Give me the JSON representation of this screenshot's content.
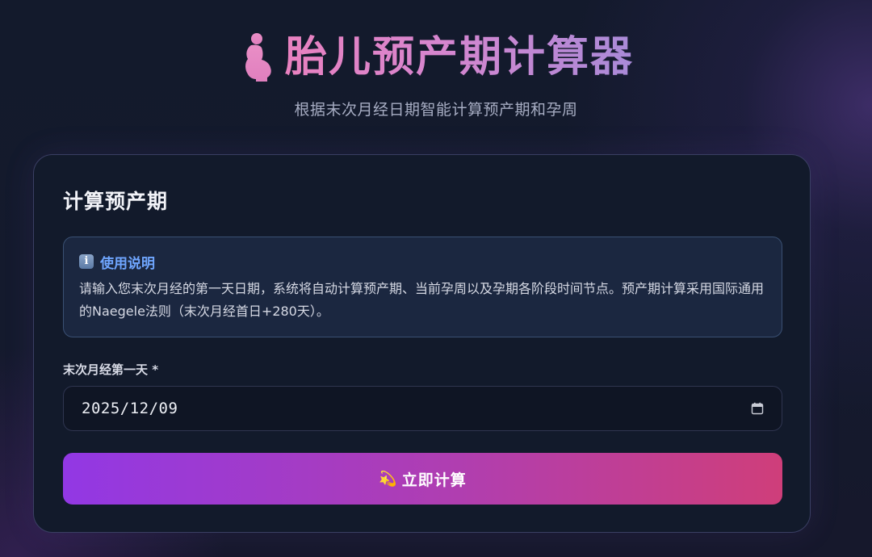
{
  "header": {
    "icon": "pregnant-silhouette-icon",
    "title": "胎儿预产期计算器",
    "subtitle": "根据末次月经日期智能计算预产期和孕周"
  },
  "card": {
    "title": "计算预产期",
    "info": {
      "icon": "info-icon",
      "icon_glyph": "i",
      "title": "使用说明",
      "text": "请输入您末次月经的第一天日期，系统将自动计算预产期、当前孕周以及孕期各阶段时间节点。预产期计算采用国际通用的Naegele法则（末次月经首日+280天）。"
    },
    "lmp_field": {
      "label": "末次月经第一天 *",
      "value": "2025/12/09",
      "icon": "calendar-icon"
    },
    "submit": {
      "icon": "dizzy-sparkle-icon",
      "icon_glyph": "💫",
      "label": "立即计算"
    }
  },
  "colors": {
    "title_gradient_start": "#e981c0",
    "title_gradient_end": "#a98ad8",
    "info_title": "#6fa6ff",
    "button_gradient_start": "#9238e4",
    "button_gradient_end": "#cf3e7a",
    "background": "#131a2c",
    "card_background": "#121a2b"
  }
}
